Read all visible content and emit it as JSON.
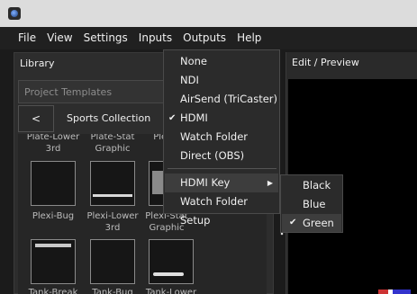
{
  "menubar": {
    "items": [
      "File",
      "View",
      "Settings",
      "Inputs",
      "Outputs",
      "Help"
    ]
  },
  "library": {
    "title": "Library",
    "templates_placeholder": "Project Templates",
    "back_label": "<",
    "collection": "Sports Collection",
    "top_labels": [
      "Plate-Lower 3rd",
      "Plate-Stat Graphic",
      "Plexi-Se"
    ],
    "thumbs": [
      {
        "label_line1": "Plexi-Bug",
        "label_line2": ""
      },
      {
        "label_line1": "Plexi-Lower",
        "label_line2": "3rd"
      },
      {
        "label_line1": "Plexi-Stat",
        "label_line2": "Graphic"
      },
      {
        "label_line1": "Tank-Break",
        "label_line2": ""
      },
      {
        "label_line1": "Tank-Bug",
        "label_line2": ""
      },
      {
        "label_line1": "Tank-Lower",
        "label_line2": ""
      }
    ]
  },
  "preview": {
    "title": "Edit / Preview"
  },
  "outputs_menu": {
    "items": [
      {
        "label": "None",
        "checked": false
      },
      {
        "label": "NDI",
        "checked": false
      },
      {
        "label": "AirSend (TriCaster)",
        "checked": false
      },
      {
        "label": "HDMI",
        "checked": true
      },
      {
        "label": "Watch Folder",
        "checked": false
      },
      {
        "label": "Direct (OBS)",
        "checked": false
      }
    ],
    "hdmi_key": "HDMI Key",
    "watch_folder_setup": "Watch Folder Setup"
  },
  "hdmi_key_submenu": {
    "items": [
      {
        "label": "Black",
        "checked": false
      },
      {
        "label": "Blue",
        "checked": false
      },
      {
        "label": "Green",
        "checked": true
      }
    ]
  },
  "icons": {
    "check": "check-icon",
    "submenu_arrow": "chevron-right-icon"
  }
}
